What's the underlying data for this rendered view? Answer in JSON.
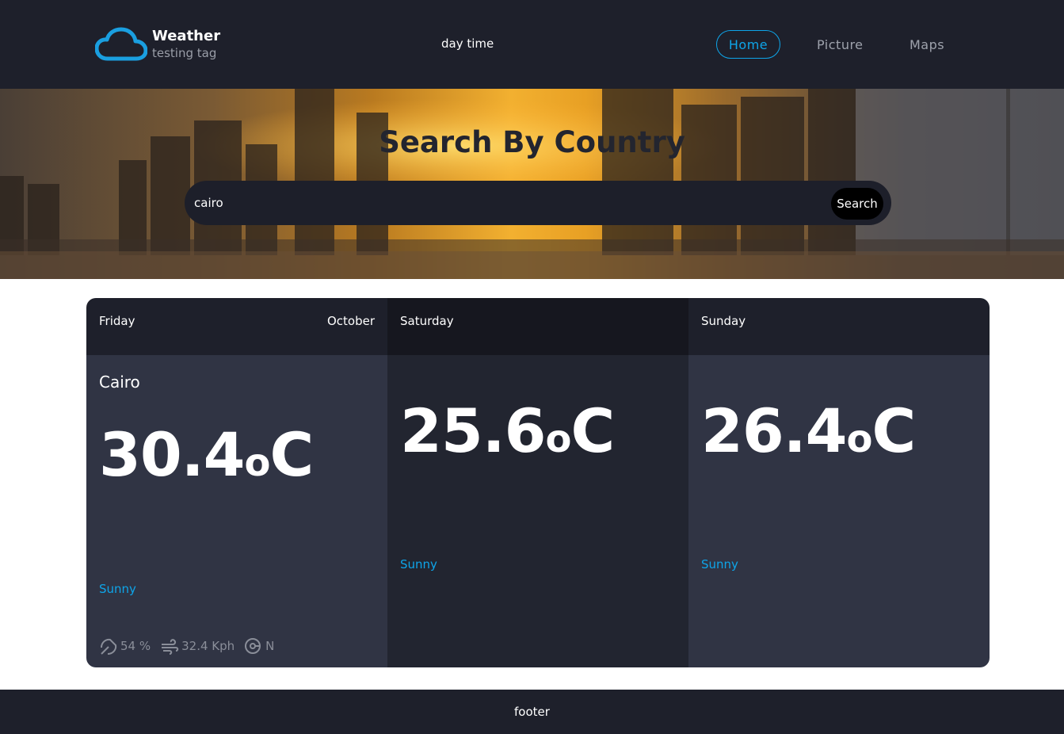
{
  "header": {
    "brand_name": "Weather",
    "brand_tag": "testing tag",
    "daytime_label": "day time",
    "nav": {
      "home": "Home",
      "picture": "Picture",
      "maps": "Maps"
    }
  },
  "hero": {
    "title": "Search By Country",
    "search_value": "cairo",
    "search_button": "Search"
  },
  "forecast": {
    "today": {
      "day": "Friday",
      "month": "October",
      "city": "Cairo",
      "temp": "30.4",
      "unit_o": "o",
      "unit_c": "C",
      "condition": "Sunny",
      "humidity": "54 %",
      "wind_speed": "32.4 Kph",
      "wind_direction": "N"
    },
    "day2": {
      "day": "Saturday",
      "temp": "25.6",
      "unit_o": "o",
      "unit_c": "C",
      "condition": "Sunny"
    },
    "day3": {
      "day": "Sunday",
      "temp": "26.4",
      "unit_o": "o",
      "unit_c": "C",
      "condition": "Sunny"
    }
  },
  "footer": {
    "text": "footer"
  },
  "colors": {
    "accent": "#0ea5e9",
    "header_bg": "#1e202b",
    "card_bg": "#303444",
    "card_alt_bg": "#222530"
  },
  "icons": {
    "logo": "cloud-icon",
    "humidity": "umbrella-icon",
    "wind": "wind-icon",
    "direction": "compass-icon"
  }
}
